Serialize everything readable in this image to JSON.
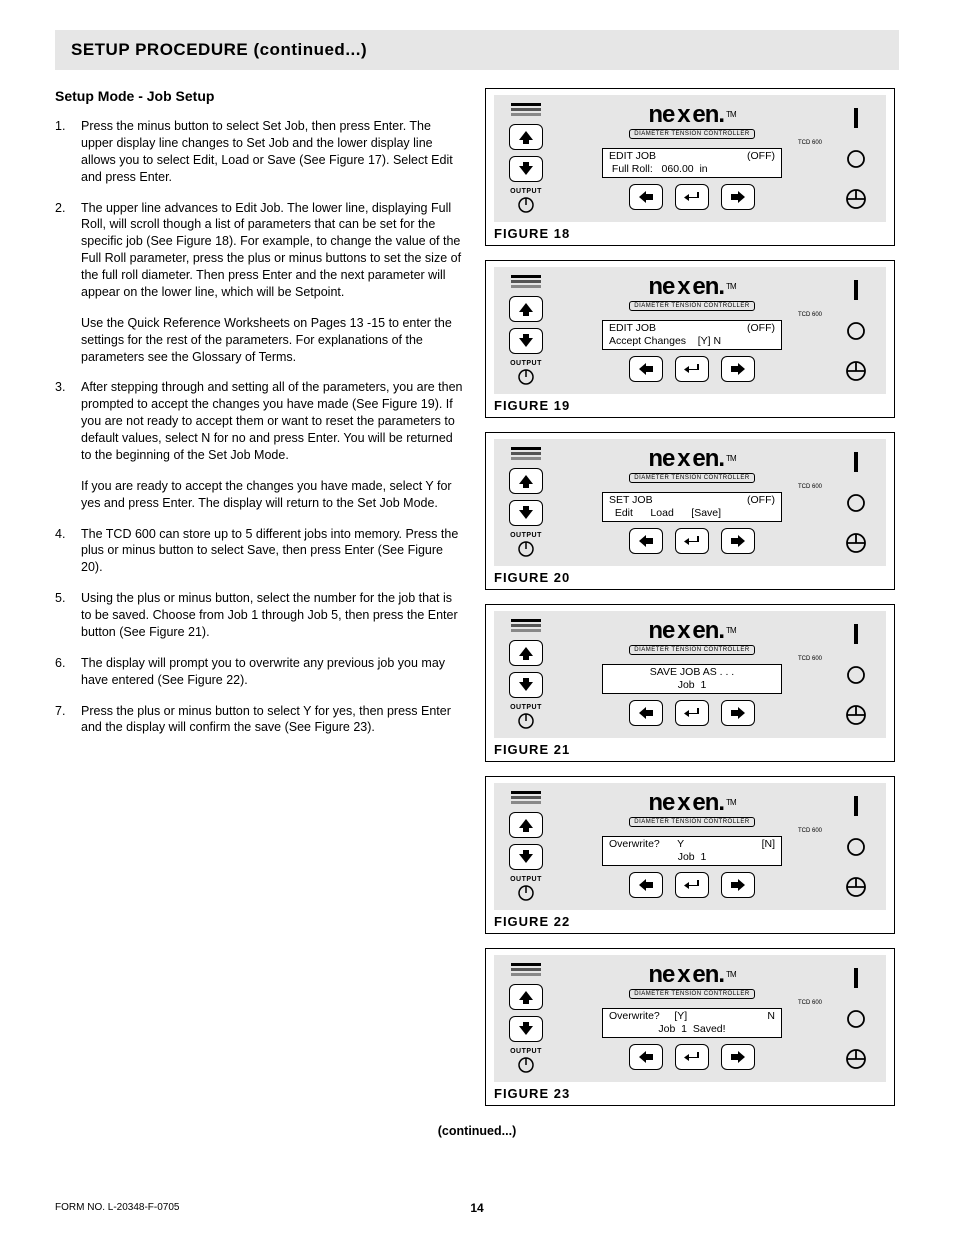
{
  "page_title": "SETUP PROCEDURE (continued...)",
  "section_title": "Setup Mode - Job Setup",
  "steps": [
    {
      "n": "1.",
      "paras": [
        "Press the minus button to select Set Job, then press Enter. The upper display line changes to Set Job and the lower display line allows you to select Edit, Load or Save (See Figure 17).  Select Edit and press Enter."
      ]
    },
    {
      "n": "2.",
      "paras": [
        "The upper line advances to Edit Job.  The lower line, displaying Full Roll, will scroll though a list of parameters that can be set for the specific job (See Figure 18).  For example, to change the value of the Full Roll parameter, press the plus or minus buttons to set the size of the full roll diameter.  Then press Enter and the next parameter will appear on the lower line, which will be Setpoint.",
        "Use the Quick Reference Worksheets on Pages 13  -15 to enter the settings for the rest of the parameters. For explanations of the parameters see the Glossary of Terms."
      ]
    },
    {
      "n": "3.",
      "paras": [
        "After stepping through and setting all of the parameters, you are then prompted to accept the changes you have made (See Figure 19).  If you are not ready to accept them or want to reset the parameters to default values, select N for no and press Enter.  You will be returned to the beginning of the Set Job Mode.",
        "If you are ready to accept the changes you have made, select Y for yes and press Enter.  The display will return to the Set Job Mode."
      ]
    },
    {
      "n": "4.",
      "paras": [
        " The TCD 600 can store up to 5 different jobs into memory. Press the plus or minus button to select Save, then press Enter (See Figure 20)."
      ]
    },
    {
      "n": "5.",
      "paras": [
        "Using the plus or minus button, select the number for the job that is to be saved. Choose from Job 1 through Job 5, then press the Enter button (See Figure 21)."
      ]
    },
    {
      "n": "6.",
      "paras": [
        "The display will prompt you to overwrite any previous job you may have entered (See Figure 22)."
      ]
    },
    {
      "n": "7.",
      "paras": [
        "Press the plus or minus button to select  Y for yes, then press Enter and the display will confirm the save (See Figure 23)."
      ]
    }
  ],
  "brand": "nexen",
  "brand_tm": "TM",
  "subbrand": "DIAMETER TENSION CONTROLLER",
  "model": "TCD 600",
  "output_label": "OUTPUT",
  "figures": [
    {
      "label": "FIGURE 18",
      "line1_left": "EDIT JOB",
      "line1_right": "(OFF)",
      "line2": " Full Roll:   060.00  in"
    },
    {
      "label": "FIGURE 19",
      "line1_left": "EDIT JOB",
      "line1_right": "(OFF)",
      "line2": "Accept Changes    [Y] N"
    },
    {
      "label": "FIGURE 20",
      "line1_left": "SET JOB",
      "line1_right": "(OFF)",
      "line2": "  Edit      Load      [Save]"
    },
    {
      "label": "FIGURE 21",
      "line1_left": "",
      "line1_right": "",
      "line1_center": "SAVE JOB AS . . .",
      "line2_center": "Job  1"
    },
    {
      "label": "FIGURE 22",
      "line1_left": "Overwrite?      Y",
      "line1_right": "[N]",
      "line2_center": "Job  1"
    },
    {
      "label": "FIGURE 23",
      "line1_left": "Overwrite?     [Y]",
      "line1_right": "N",
      "line2_center": "Job  1  Saved!"
    }
  ],
  "continued": "(continued...)",
  "form_no": "FORM NO. L-20348-F-0705",
  "page_no": "14"
}
